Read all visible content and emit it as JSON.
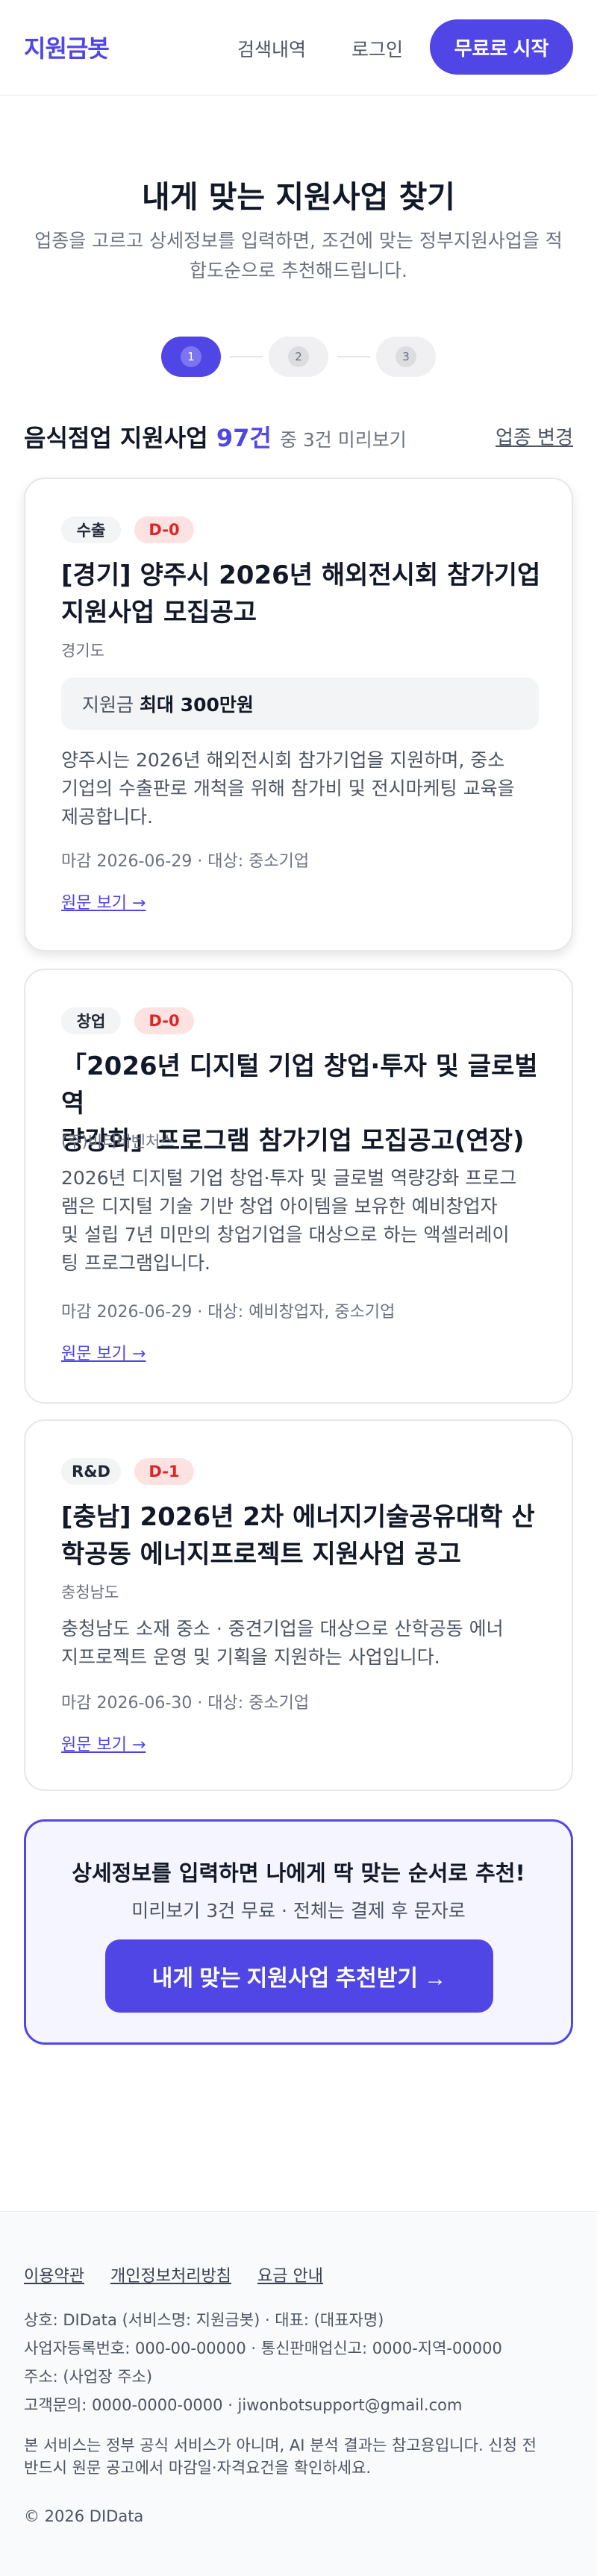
{
  "header": {
    "logo": "지원금봇",
    "nav": {
      "search": "검색내역",
      "login": "로그인"
    },
    "cta": "무료로 시작"
  },
  "hero": {
    "title": "내게 맞는 지원사업 찾기",
    "subtitle_line1": "업종을 고르고 상세정보를 입력하면, 조건에 맞는 정부지원사업을 적",
    "subtitle_line2": "합도순으로 추천해드립니다."
  },
  "stepper": {
    "steps": [
      "1",
      "2",
      "3"
    ],
    "active": 1
  },
  "results": {
    "title": "음식점업 지원사업",
    "count": "97건",
    "note": "중 3건 미리보기",
    "change_link": "업종 변경"
  },
  "cards": [
    {
      "category": "수출",
      "dday": "D-0",
      "title_line1": "[경기] 양주시 2026년 해외전시회 참가기업",
      "title_line2": "지원사업 모집공고",
      "org": "경기도",
      "amount_label": "지원금",
      "amount_value": "최대 300만원",
      "desc_lines": [
        "양주시는 2026년 해외전시회 참가기업을 지원하며, 중소",
        "기업의 수출판로 개척을 위해 참가비 및 전시마케팅 교육을",
        "제공합니다."
      ],
      "meta": "마감 2026-06-29 · 대상: 중소기업",
      "link": "원문 보기 →"
    },
    {
      "category": "창업",
      "dday": "D-0",
      "title_line1": "「2026년 디지털 기업 창업·투자 및 글로벌 역",
      "title_line2": "량강화」프로그램 참가기업 모집공고(연장)",
      "org": "(주)비티비벤처스",
      "desc_lines": [
        "2026년 디지털 기업 창업·투자 및 글로벌 역량강화 프로그",
        "램은 디지털 기술 기반 창업 아이템을 보유한 예비창업자",
        "및 설립 7년 미만의 창업기업을 대상으로 하는 액셀러레이",
        "팅 프로그램입니다."
      ],
      "meta": "마감 2026-06-29 · 대상: 예비창업자, 중소기업",
      "link": "원문 보기 →"
    },
    {
      "category": "R&D",
      "dday": "D-1",
      "title_line1": "[충남] 2026년 2차 에너지기술공유대학 산",
      "title_line2": "학공동 에너지프로젝트 지원사업 공고",
      "org": "충청남도",
      "desc_lines": [
        "충청남도 소재 중소 · 중견기업을 대상으로 산학공동 에너",
        "지프로젝트 운영 및 기획을 지원하는 사업입니다."
      ],
      "meta": "마감 2026-06-30 · 대상: 중소기업",
      "link": "원문 보기 →"
    }
  ],
  "cta_box": {
    "title": "상세정보를 입력하면 나에게 딱 맞는 순서로 추천!",
    "subtitle": "미리보기 3건 무료 · 전체는 결제 후 문자로",
    "button": "내게 맞는 지원사업 추천받기 →"
  },
  "footer": {
    "links": [
      "이용약관",
      "개인정보처리방침",
      "요금 안내"
    ],
    "company": "상호: DIData (서비스명: 지원금봇) · 대표: (대표자명)",
    "registration": "사업자등록번호: 000-00-00000 · 통신판매업신고: 0000-지역-00000",
    "address": "주소: (사업장 주소)",
    "contact": "고객문의: 0000-0000-0000 · jiwonbotsupport@gmail.com",
    "disclaimer_line1": "본 서비스는 정부 공식 서비스가 아니며, AI 분석 결과는 참고용입니다. 신청 전",
    "disclaimer_line2": "반드시 원문 공고에서 마감일·자격요건을 확인하세요.",
    "copyright": "© 2026 DIData"
  }
}
